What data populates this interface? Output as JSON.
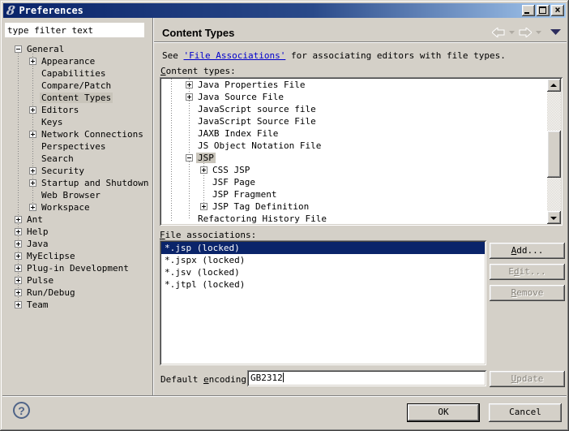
{
  "window": {
    "title": "Preferences",
    "icon_glyph": "8"
  },
  "titlebar": {
    "buttons": [
      "minimize",
      "maximize",
      "close"
    ],
    "close_glyph": "×"
  },
  "colors": {
    "titlebar_start": "#0a246a",
    "titlebar_end": "#a6caf0",
    "background": "#d4d0c8",
    "selection_active": "#0a246a",
    "selection_inactive": "#c8c4ba",
    "link": "#0000cc"
  },
  "header": {
    "title": "Content Types"
  },
  "nav": {
    "icons": [
      "back-arrow",
      "back-history-caret",
      "forward-arrow",
      "forward-history-caret",
      "view-menu-triangle"
    ]
  },
  "fields": {
    "filter": "type filter text",
    "encoding_value": "GB2312"
  },
  "see": {
    "pre": "See ",
    "link": "'File Associations'",
    "post": " for associating editors with file types."
  },
  "labels": {
    "content_types": {
      "pre": "",
      "key": "C",
      "post": "ontent types:"
    },
    "file_assoc": {
      "pre": "",
      "key": "F",
      "post": "ile associations:"
    },
    "encoding": {
      "pre": "Default ",
      "key": "e",
      "post": "ncoding:"
    }
  },
  "buttons": {
    "add": {
      "pre": "",
      "key": "A",
      "post": "dd...",
      "enabled": true
    },
    "edit": {
      "pre": "E",
      "key": "d",
      "post": "it...",
      "enabled": false
    },
    "remove": {
      "pre": "",
      "key": "R",
      "post": "emove",
      "enabled": false
    },
    "update": {
      "pre": "",
      "key": "U",
      "post": "pdate",
      "enabled": false
    },
    "ok": "OK",
    "cancel": "Cancel"
  },
  "footer": {
    "help": "?"
  },
  "sidebar": {
    "items": [
      {
        "label": "General",
        "lvl": 0,
        "expand": "minus",
        "selected": false
      },
      {
        "label": "Appearance",
        "lvl": 1,
        "expand": "plus",
        "selected": false
      },
      {
        "label": "Capabilities",
        "lvl": 1,
        "expand": "none",
        "selected": false
      },
      {
        "label": "Compare/Patch",
        "lvl": 1,
        "expand": "none",
        "selected": false
      },
      {
        "label": "Content Types",
        "lvl": 1,
        "expand": "none",
        "selected": true
      },
      {
        "label": "Editors",
        "lvl": 1,
        "expand": "plus",
        "selected": false
      },
      {
        "label": "Keys",
        "lvl": 1,
        "expand": "none",
        "selected": false
      },
      {
        "label": "Network Connections",
        "lvl": 1,
        "expand": "plus",
        "selected": false
      },
      {
        "label": "Perspectives",
        "lvl": 1,
        "expand": "none",
        "selected": false
      },
      {
        "label": "Search",
        "lvl": 1,
        "expand": "none",
        "selected": false
      },
      {
        "label": "Security",
        "lvl": 1,
        "expand": "plus",
        "selected": false
      },
      {
        "label": "Startup and Shutdown",
        "lvl": 1,
        "expand": "plus",
        "selected": false
      },
      {
        "label": "Web Browser",
        "lvl": 1,
        "expand": "none",
        "selected": false
      },
      {
        "label": "Workspace",
        "lvl": 1,
        "expand": "plus",
        "selected": false
      },
      {
        "label": "Ant",
        "lvl": 0,
        "expand": "plus",
        "selected": false
      },
      {
        "label": "Help",
        "lvl": 0,
        "expand": "plus",
        "selected": false
      },
      {
        "label": "Java",
        "lvl": 0,
        "expand": "plus",
        "selected": false
      },
      {
        "label": "MyEclipse",
        "lvl": 0,
        "expand": "plus",
        "selected": false
      },
      {
        "label": "Plug-in Development",
        "lvl": 0,
        "expand": "plus",
        "selected": false
      },
      {
        "label": "Pulse",
        "lvl": 0,
        "expand": "plus",
        "selected": false
      },
      {
        "label": "Run/Debug",
        "lvl": 0,
        "expand": "plus",
        "selected": false
      },
      {
        "label": "Team",
        "lvl": 0,
        "expand": "plus",
        "selected": false
      }
    ]
  },
  "content_types_tree": {
    "items": [
      {
        "label": "Java Properties File",
        "lvl": 1,
        "expand": "plus",
        "selected": false
      },
      {
        "label": "Java Source File",
        "lvl": 1,
        "expand": "plus",
        "selected": false
      },
      {
        "label": "JavaScript source file",
        "lvl": 1,
        "expand": "none",
        "selected": false
      },
      {
        "label": "JavaScript Source File",
        "lvl": 1,
        "expand": "none",
        "selected": false
      },
      {
        "label": "JAXB Index File",
        "lvl": 1,
        "expand": "none",
        "selected": false
      },
      {
        "label": "JS Object Notation File",
        "lvl": 1,
        "expand": "none",
        "selected": false
      },
      {
        "label": "JSP",
        "lvl": 1,
        "expand": "minus",
        "selected": true
      },
      {
        "label": "CSS JSP",
        "lvl": 2,
        "expand": "plus",
        "selected": false
      },
      {
        "label": "JSF Page",
        "lvl": 2,
        "expand": "none",
        "selected": false
      },
      {
        "label": "JSP Fragment",
        "lvl": 2,
        "expand": "none",
        "selected": false
      },
      {
        "label": "JSP Tag Definition",
        "lvl": 2,
        "expand": "plus",
        "selected": false
      },
      {
        "label": "Refactoring History File",
        "lvl": 1,
        "expand": "none",
        "selected": false
      }
    ]
  },
  "associations": {
    "items": [
      {
        "label": "*.jsp (locked)",
        "selected": true
      },
      {
        "label": "*.jspx (locked)",
        "selected": false
      },
      {
        "label": "*.jsv (locked)",
        "selected": false
      },
      {
        "label": "*.jtpl (locked)",
        "selected": false
      }
    ]
  }
}
